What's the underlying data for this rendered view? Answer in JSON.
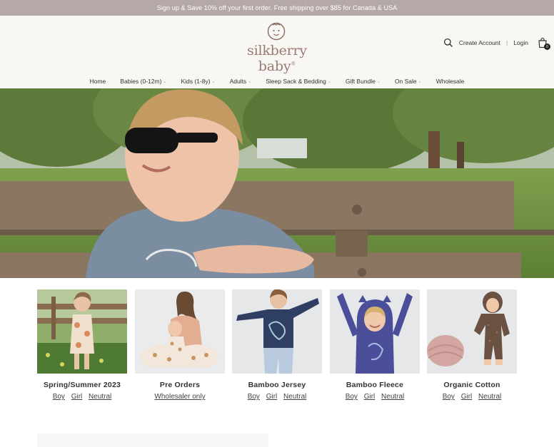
{
  "announcement": "Sign up & Save 10% off your first order. Free shipping over $85 for Canada & USA",
  "brand": {
    "name": "silkberry baby",
    "trademark": "®"
  },
  "header": {
    "create_account": "Create Account",
    "separator": "|",
    "login": "Login",
    "cart_count": "0"
  },
  "nav": [
    {
      "label": "Home",
      "dropdown": false
    },
    {
      "label": "Babies (0-12m)",
      "dropdown": true
    },
    {
      "label": "Kids (1-8y)",
      "dropdown": true
    },
    {
      "label": "Adults",
      "dropdown": true
    },
    {
      "label": "Sleep Sack & Bedding",
      "dropdown": true
    },
    {
      "label": "Gift Bundle",
      "dropdown": true
    },
    {
      "label": "On Sale",
      "dropdown": true
    },
    {
      "label": "Wholesale",
      "dropdown": false
    }
  ],
  "categories": [
    {
      "title": "Spring/Summer 2023",
      "links": [
        "Boy",
        "Girl",
        "Neutral"
      ]
    },
    {
      "title": "Pre Orders",
      "links": [
        "Wholesaler only"
      ]
    },
    {
      "title": "Bamboo Jersey",
      "links": [
        "Boy",
        "Girl",
        "Neutral"
      ]
    },
    {
      "title": "Bamboo Fleece",
      "links": [
        "Boy",
        "Girl",
        "Neutral"
      ]
    },
    {
      "title": "Organic Cotton",
      "links": [
        "Boy",
        "Girl",
        "Neutral"
      ]
    }
  ],
  "colors": {
    "announcement_bg": "#b4a8a9",
    "header_bg": "#f8f7f4",
    "brand_text": "#9a7a72"
  },
  "icons": {
    "search": "search-icon",
    "cart": "shopping-bag-icon",
    "logo": "baby-face-icon"
  }
}
